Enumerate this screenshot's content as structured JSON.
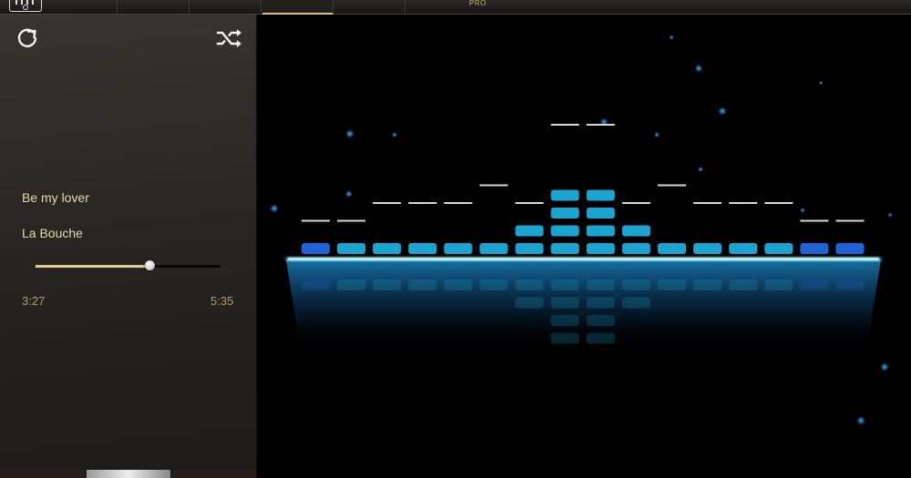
{
  "header": {
    "tab_label": "PRO"
  },
  "player": {
    "song_title": "Be my lover",
    "artist": "La Bouche",
    "time_elapsed": "3:27",
    "time_total": "5:35",
    "progress_fraction": 0.62
  },
  "icons": {
    "app": "equalizer-app-icon",
    "repeat": "repeat-icon",
    "shuffle": "shuffle-icon"
  },
  "visualizer": {
    "bar_levels": [
      1,
      1,
      1,
      1,
      1,
      1,
      2,
      4,
      4,
      2,
      1,
      1,
      1,
      1,
      1,
      1
    ],
    "peak_levels": [
      2,
      2,
      3,
      3,
      3,
      4,
      3,
      7,
      7,
      3,
      4,
      3,
      3,
      3,
      2,
      2
    ],
    "colors": {
      "bar": "#1aa4cf",
      "bar_edge": "#1e64d6",
      "peak": "#d8d8d8",
      "floor": "#7ff3ff"
    }
  }
}
